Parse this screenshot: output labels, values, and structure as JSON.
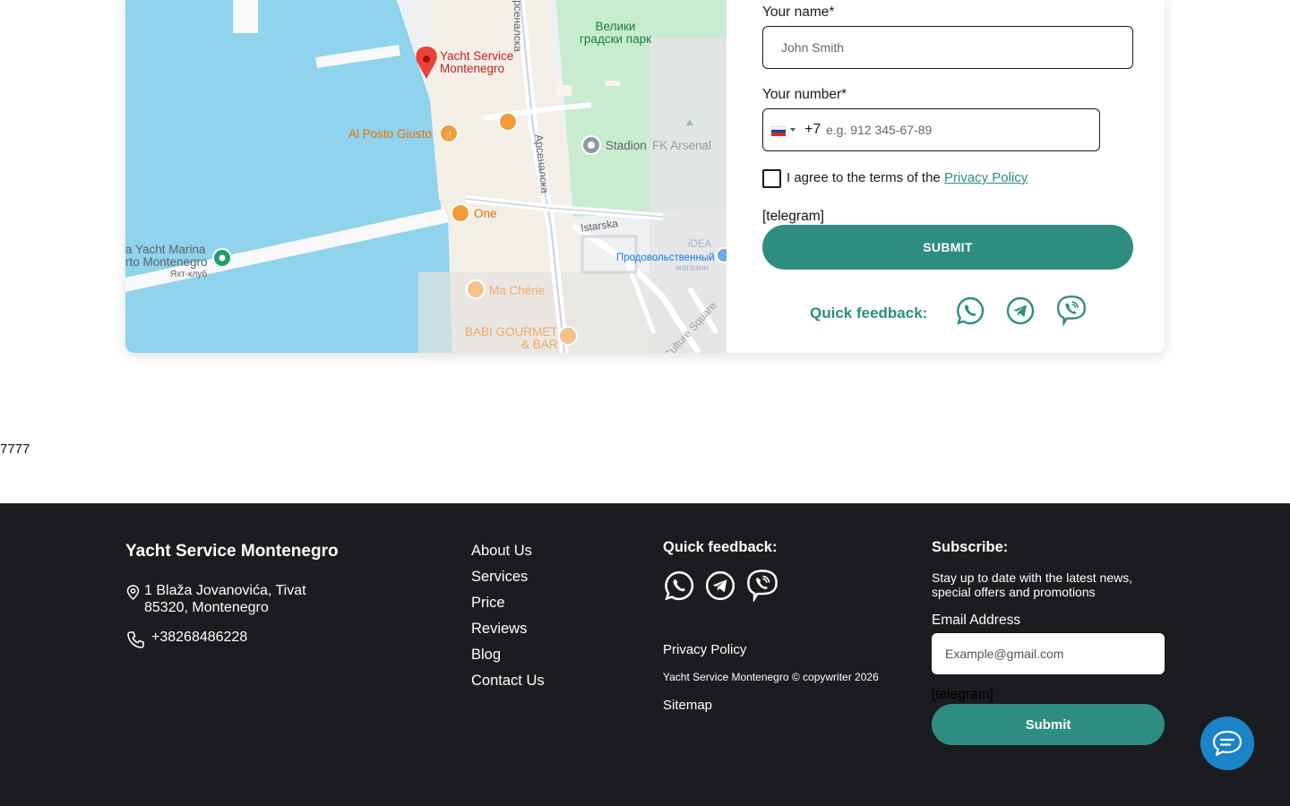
{
  "map": {
    "labels": {
      "yacht_service_line1": "Yacht Service",
      "yacht_service_line2": "Montenegro",
      "veliki_line1": "Велики",
      "veliki_line2": "градски парк",
      "al_posto_giusto": "Al Posto Giusto",
      "stadion": "Stadion",
      "fk_arsenal": "FK Arsenal",
      "one": "One",
      "istarska": "Istarska",
      "arsenalska_top": "Арсеналска",
      "arsenalska_mid": "Арсеналска",
      "marina_line1": "a Yacht Marina",
      "marina_line2": "rto Montenegro",
      "marina_line3": "Яхт-клуб",
      "idea_line1": "iDEA",
      "idea_line2": "Продовольственный",
      "idea_line3": "магазин",
      "ma_cherie": "Ma Chérie",
      "babi_line1": "BABI GOURMET",
      "babi_line2": "& BAR",
      "culture_square": "Culture Square"
    }
  },
  "form": {
    "name_label": "Your name*",
    "name_placeholder": "John Smith",
    "number_label": "Your number*",
    "dial_code": "+7",
    "number_placeholder": "e.g. 912 345-67-89",
    "agree_text": "I agree to the terms of the ",
    "privacy_link": "Privacy Policy",
    "telegram_text": "[telegram]",
    "submit_label": "SUBMIT",
    "quick_feedback_label": "Quick feedback:"
  },
  "stray_text": "7777",
  "footer": {
    "brand": "Yacht Service Montenegro",
    "address_line1": "1 Blaža Jovanovića, Tivat",
    "address_line2": "85320, Montenegro",
    "phone": "+38268486228",
    "nav": [
      "About Us",
      "Services",
      "Price",
      "Reviews",
      "Blog",
      "Contact Us"
    ],
    "quick_feedback_title": "Quick feedback:",
    "privacy_policy": "Privacy Policy",
    "copyright": "Yacht Service Montenegro © copywriter 2026",
    "sitemap": "Sitemap",
    "subscribe_title": "Subscribe:",
    "subscribe_text": "Stay up to date with the latest news, special offers and promotions",
    "email_label": "Email Address",
    "email_placeholder": "Example@gmail.com",
    "telegram_text": "[telegram]",
    "submit_label": "Submit"
  },
  "colors": {
    "accent": "#2d8d80",
    "footer_bg": "#1b1c1f",
    "chat_button": "#1a84c7",
    "water": "#8fd3ec",
    "park": "#c8ecd0"
  },
  "icons": {
    "quick_feedback": [
      "whatsapp-icon",
      "telegram-icon",
      "viber-icon"
    ],
    "footer": [
      "location-pin-icon",
      "phone-icon"
    ],
    "chat": "chat-bubble-icon"
  }
}
